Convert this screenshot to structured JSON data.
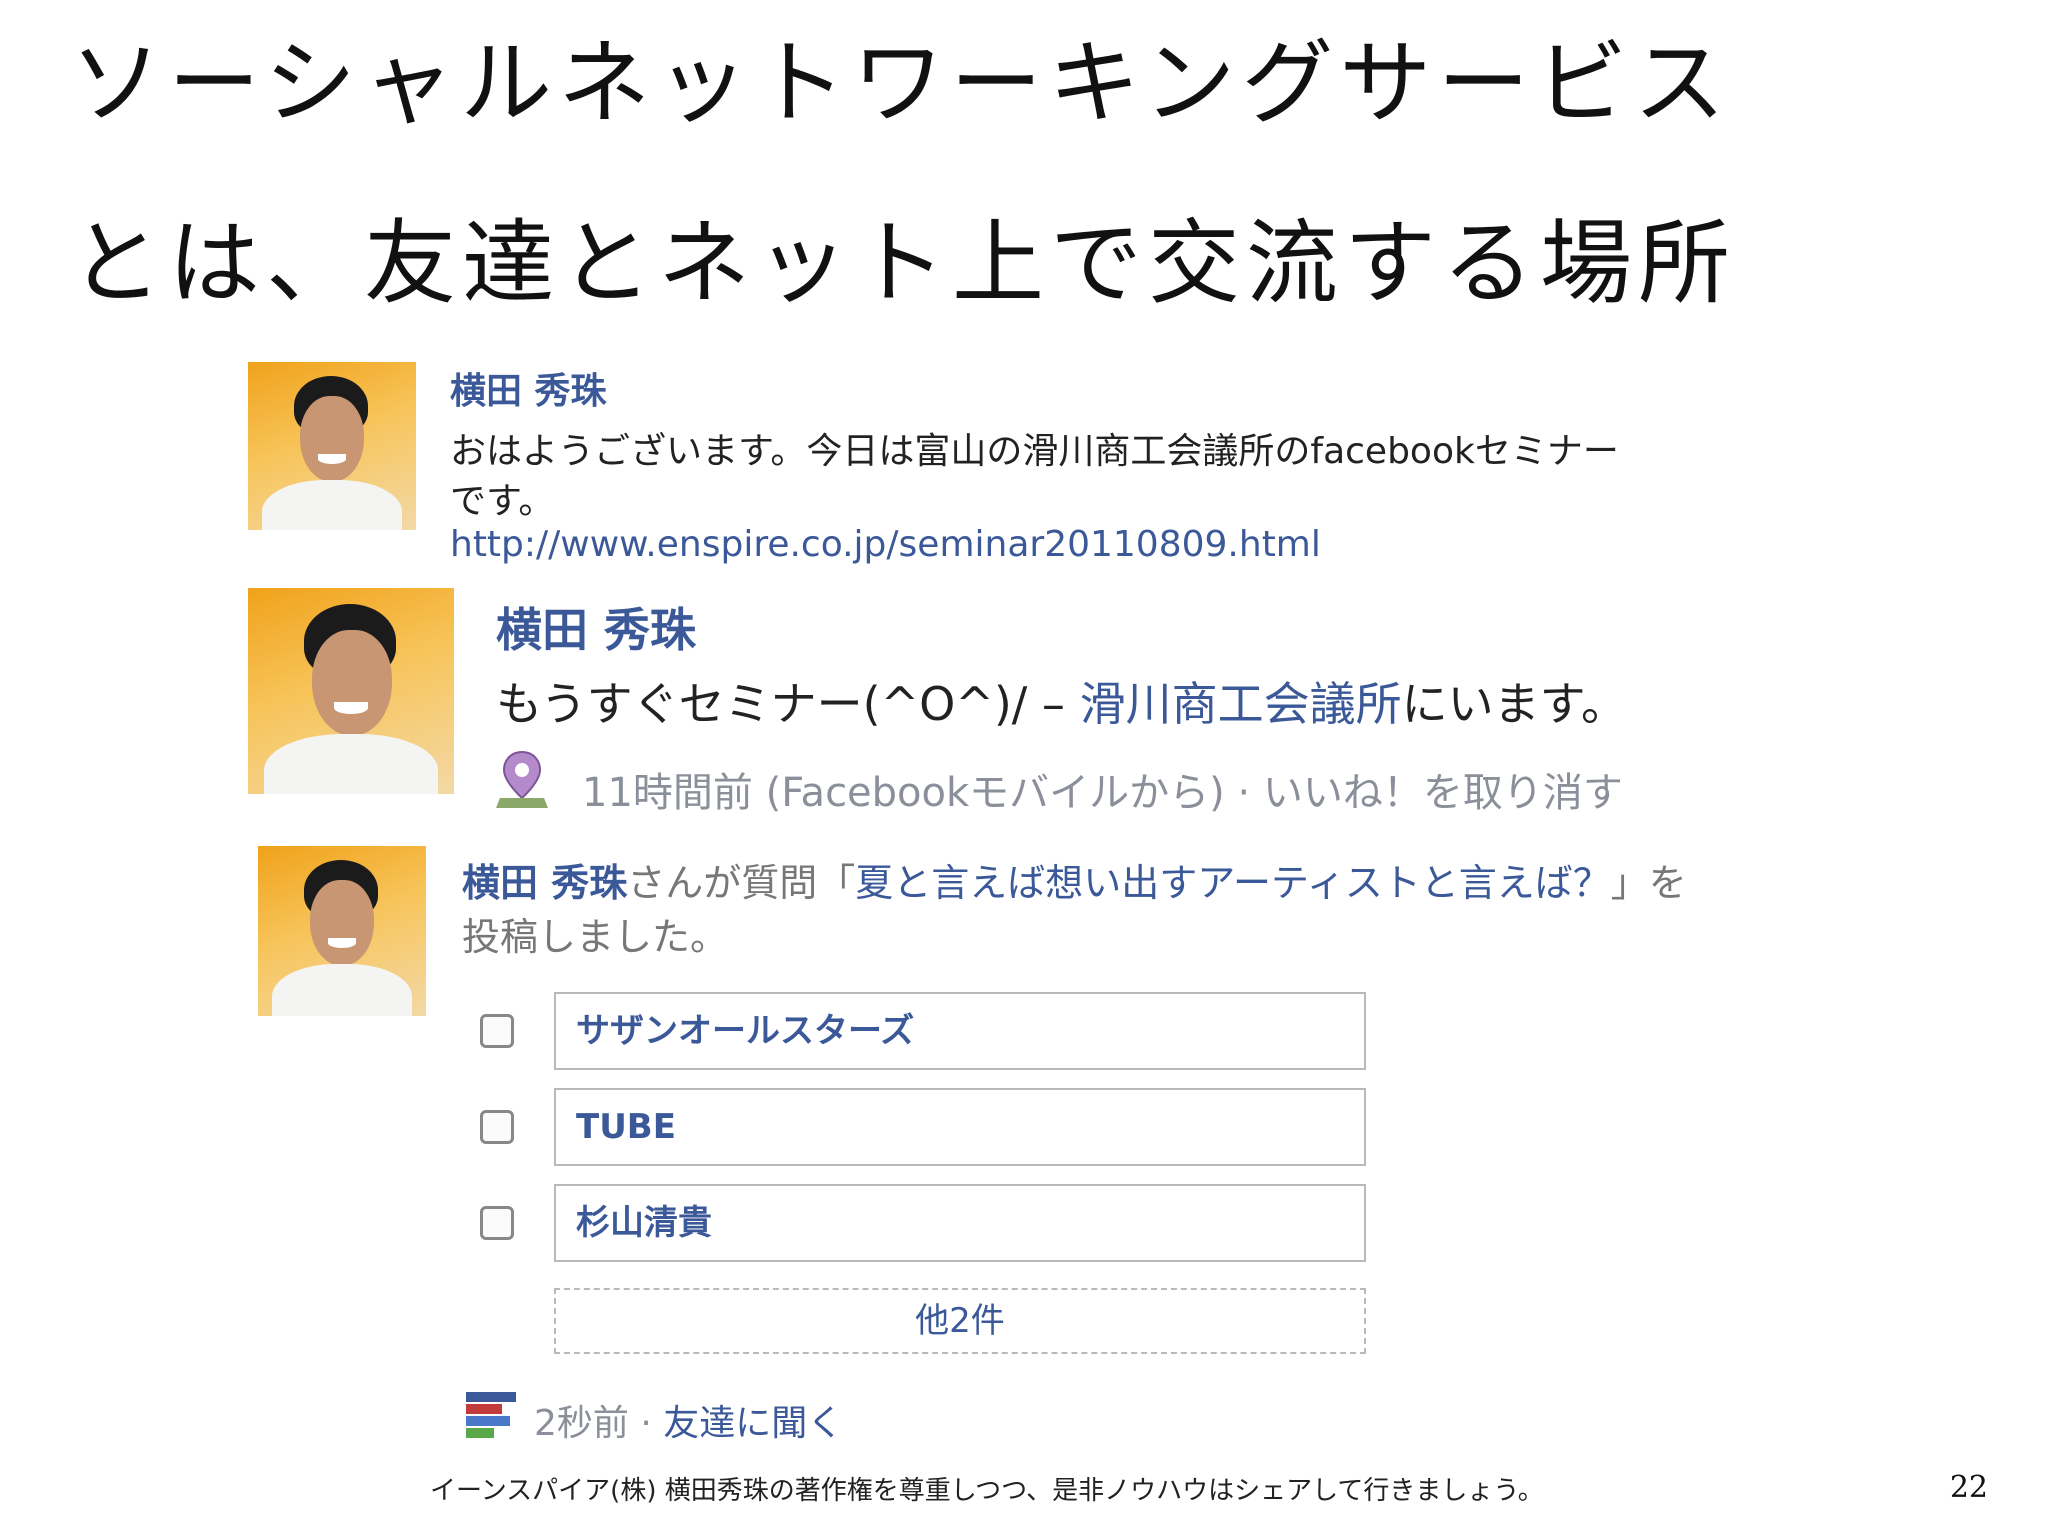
{
  "slide": {
    "title_line1": "ソーシャルネットワーキングサービス",
    "title_line2": "とは、友達とネット上で交流する場所",
    "footer": "イーンスパイア(株) 横田秀珠の著作権を尊重しつつ、是非ノウハウはシェアして行きましょう。",
    "page_number": "22"
  },
  "posts": [
    {
      "author": "横田 秀珠",
      "text_line1": "おはようございます。今日は富山の滑川商工会議所のfacebookセミナー",
      "text_line2": "です。",
      "link": "http://www.enspire.co.jp/seminar20110809.html"
    },
    {
      "author": "横田 秀珠",
      "text": "もうすぐセミナー(^O^)/ – ",
      "place": "滑川商工会議所",
      "text_suffix": "にいます。",
      "meta": "11時間前 (Facebookモバイルから) · いいね！を取り消す",
      "icon": "location-pin-icon"
    },
    {
      "author": "横田 秀珠",
      "text_pre": "さんが質問「",
      "question": "夏と言えば想い出すアーティストと言えば？",
      "text_post": "」を",
      "text_line2": "投稿しました。",
      "options": [
        "サザンオールスターズ",
        "TUBE",
        "杉山清貴"
      ],
      "more": "他2件",
      "meta_time": "2秒前",
      "meta_sep": " · ",
      "meta_action": "友達に聞く",
      "icon": "poll-icon"
    }
  ],
  "colors": {
    "facebook_blue": "#3b5998",
    "meta_gray": "#8a8f9a"
  }
}
